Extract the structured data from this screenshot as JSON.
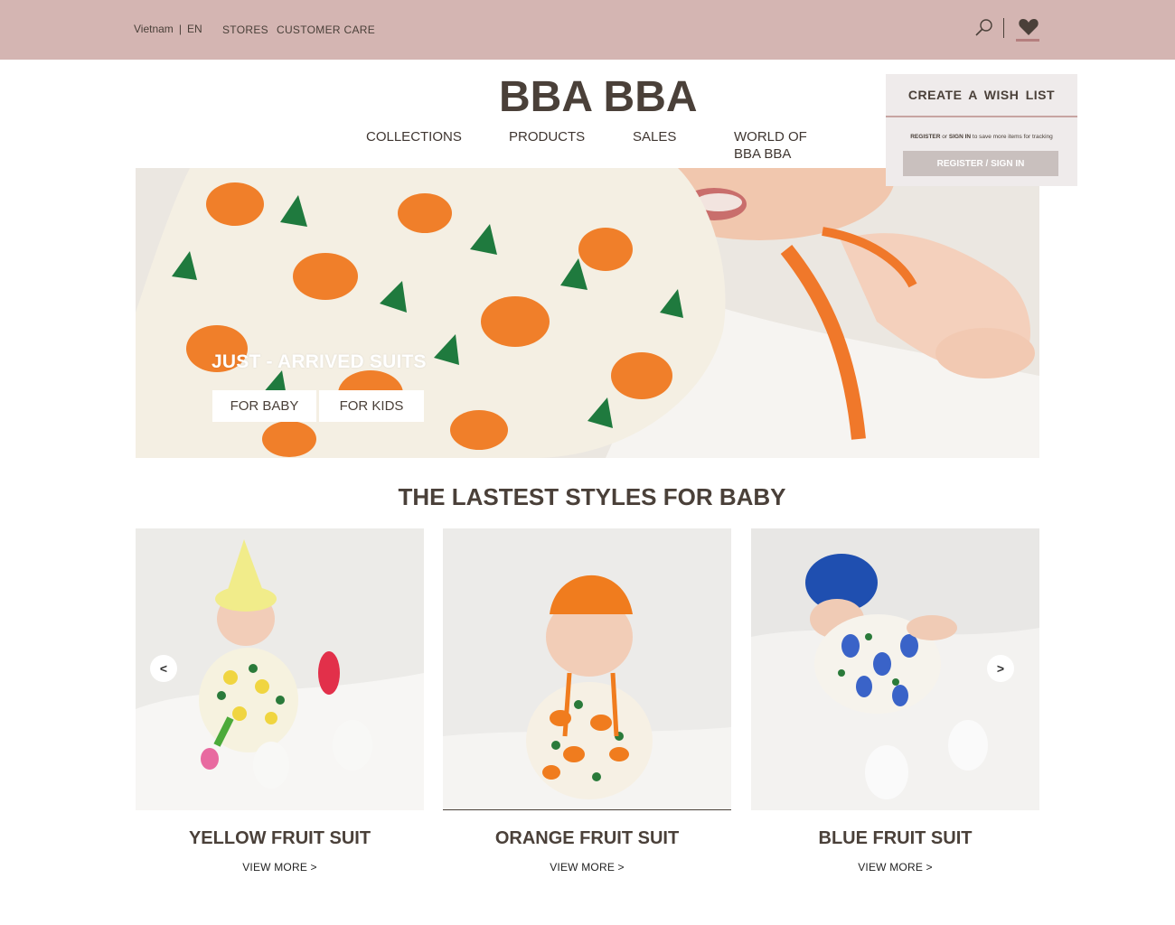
{
  "topbar": {
    "region": "Vietnam",
    "language": "EN",
    "links": [
      "STORES",
      "CUSTOMER CARE"
    ],
    "icons": [
      "search-icon",
      "heart-icon"
    ],
    "color": "#d4b5b2"
  },
  "header": {
    "logo": "BBA BBA",
    "nav": [
      "COLLECTIONS",
      "PRODUCTS",
      "SALES",
      "WORLD OF BBA BBA"
    ]
  },
  "wishlist": {
    "title": "CREATE  A  WISH  LIST",
    "note_register": "REGISTER",
    "note_or": " or ",
    "note_signin": "SIGN IN",
    "note_rest": " to save more items for tracking",
    "button": "REGISTER / SIGN IN"
  },
  "hero": {
    "title": "JUST - ARRIVED SUITS",
    "buttons": [
      "FOR BABY",
      "FOR KIDS"
    ]
  },
  "section": {
    "title": "THE LASTEST STYLES FOR BABY",
    "prev": "<",
    "next": ">"
  },
  "products": [
    {
      "name": "YELLOW FRUIT SUIT",
      "link": "VIEW MORE  >"
    },
    {
      "name": "ORANGE FRUIT SUIT",
      "link": "VIEW MORE  >"
    },
    {
      "name": "BLUE FRUIT SUIT",
      "link": "VIEW MORE  >"
    }
  ]
}
